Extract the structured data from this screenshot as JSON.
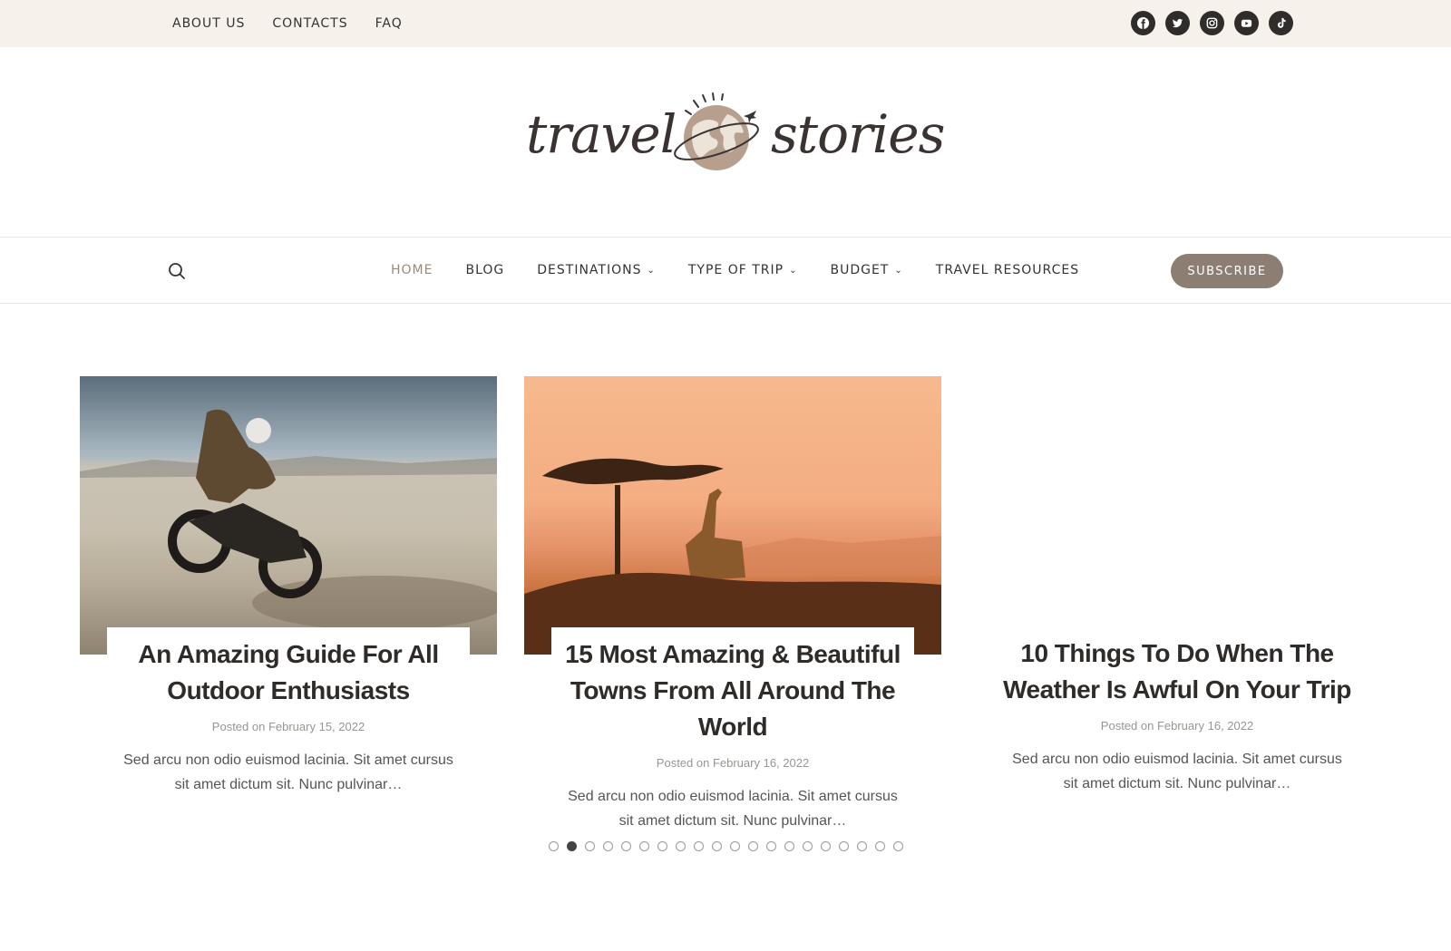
{
  "topbar": {
    "links": [
      "ABOUT US",
      "CONTACTS",
      "FAQ"
    ],
    "socials": [
      "facebook-icon",
      "twitter-icon",
      "instagram-icon",
      "youtube-icon",
      "tiktok-icon"
    ]
  },
  "logo": {
    "left_word": "travel",
    "right_word": "stories"
  },
  "nav": {
    "items": [
      {
        "label": "HOME",
        "active": true,
        "dropdown": false
      },
      {
        "label": "BLOG",
        "active": false,
        "dropdown": false
      },
      {
        "label": "DESTINATIONS",
        "active": false,
        "dropdown": true
      },
      {
        "label": "TYPE OF TRIP",
        "active": false,
        "dropdown": true
      },
      {
        "label": "BUDGET",
        "active": false,
        "dropdown": true
      },
      {
        "label": "TRAVEL RESOURCES",
        "active": false,
        "dropdown": false
      }
    ],
    "subscribe_label": "SUBSCRIBE"
  },
  "posts": [
    {
      "title": "An Amazing Guide For All Outdoor Enthusiasts",
      "meta": "Posted on February 15, 2022",
      "excerpt": "Sed arcu non odio euismod lacinia. Sit amet cursus sit amet dictum sit. Nunc pulvinar…"
    },
    {
      "title": "15 Most Amazing & Beautiful Towns From All Around The World",
      "meta": "Posted on February 16, 2022",
      "excerpt": "Sed arcu non odio euismod lacinia. Sit amet cursus sit amet dictum sit. Nunc pulvinar…"
    },
    {
      "title": "10 Things To Do When The Weather Is Awful On Your Trip",
      "meta": "Posted on February 16, 2022",
      "excerpt": "Sed arcu non odio euismod lacinia. Sit amet cursus sit amet dictum sit. Nunc pulvinar…"
    }
  ],
  "carousel": {
    "dot_count": 20,
    "active_index": 1
  },
  "colors": {
    "topbar_bg": "#f6f1eb",
    "accent": "#8c7e72",
    "active_nav": "#9b8a7c"
  }
}
